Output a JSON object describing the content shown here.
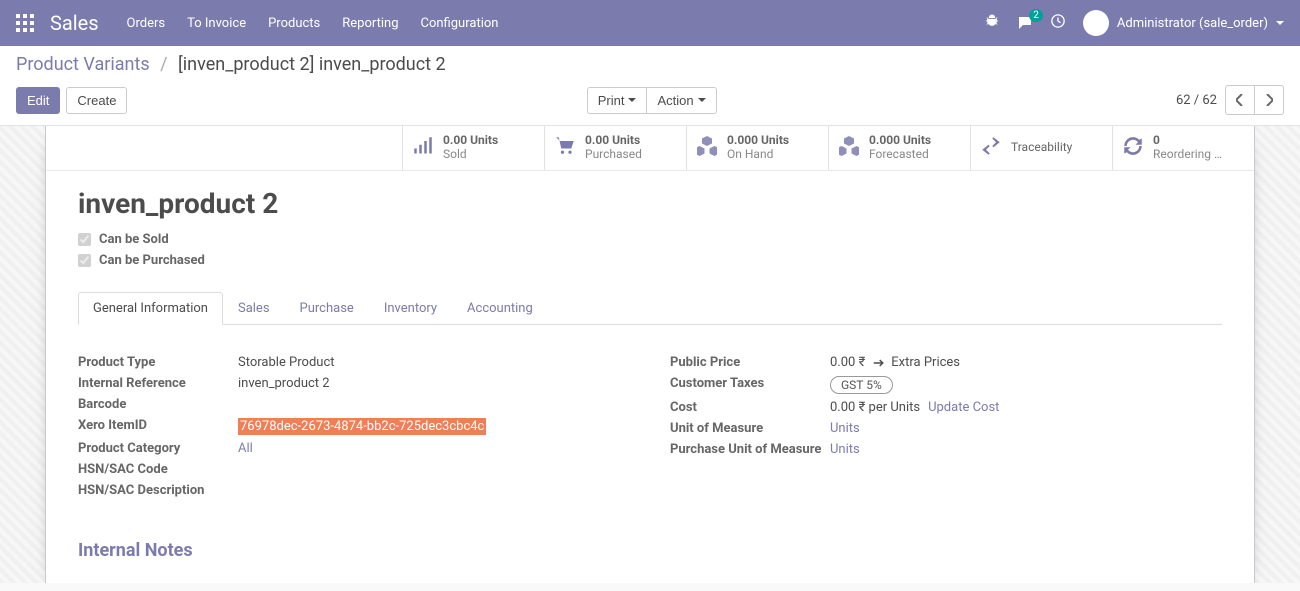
{
  "navbar": {
    "brand": "Sales",
    "menu": [
      "Orders",
      "To Invoice",
      "Products",
      "Reporting",
      "Configuration"
    ],
    "chat_count": "2",
    "user_name": "Administrator (sale_order)"
  },
  "breadcrumb": {
    "root": "Product Variants",
    "current": "[inven_product 2] inven_product 2"
  },
  "buttons": {
    "edit": "Edit",
    "create": "Create",
    "print": "Print",
    "action": "Action"
  },
  "pager": {
    "text": "62 / 62"
  },
  "stats": {
    "sold": {
      "val": "0.00 Units",
      "lbl": "Sold"
    },
    "purchased": {
      "val": "0.00 Units",
      "lbl": "Purchased"
    },
    "onhand": {
      "val": "0.000 Units",
      "lbl": "On Hand"
    },
    "forecast": {
      "val": "0.000 Units",
      "lbl": "Forecasted"
    },
    "trace": {
      "lbl": "Traceability"
    },
    "reorder": {
      "val": "0",
      "lbl": "Reordering …"
    }
  },
  "product": {
    "name": "inven_product 2",
    "can_be_sold": "Can be Sold",
    "can_be_purchased": "Can be Purchased"
  },
  "tabs": [
    "General Information",
    "Sales",
    "Purchase",
    "Inventory",
    "Accounting"
  ],
  "fields": {
    "left": {
      "product_type": {
        "label": "Product Type",
        "value": "Storable Product"
      },
      "internal_ref": {
        "label": "Internal Reference",
        "value": "inven_product 2"
      },
      "barcode": {
        "label": "Barcode",
        "value": ""
      },
      "xero_itemid": {
        "label": "Xero ItemID",
        "value": "76978dec-2673-4874-bb2c-725dec3cbc4c"
      },
      "category": {
        "label": "Product Category",
        "value": "All"
      },
      "hsn_code": {
        "label": "HSN/SAC Code",
        "value": ""
      },
      "hsn_desc": {
        "label": "HSN/SAC Description",
        "value": ""
      }
    },
    "right": {
      "public_price": {
        "label": "Public Price",
        "value": "0.00 ₹",
        "extra": "Extra Prices"
      },
      "customer_taxes": {
        "label": "Customer Taxes",
        "value": "GST 5%"
      },
      "cost": {
        "label": "Cost",
        "value": "0.00 ₹  per Units",
        "update": "Update Cost"
      },
      "uom": {
        "label": "Unit of Measure",
        "value": "Units"
      },
      "purchase_uom": {
        "label": "Purchase Unit of Measure",
        "value": "Units"
      }
    }
  },
  "section": {
    "internal_notes": "Internal Notes"
  }
}
